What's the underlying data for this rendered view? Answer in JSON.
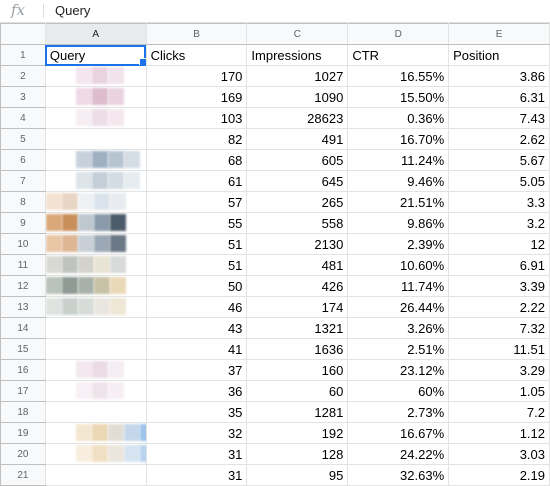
{
  "formula_bar": {
    "fx_label": "fx",
    "value": "Query"
  },
  "column_letters": [
    "A",
    "B",
    "C",
    "D",
    "E"
  ],
  "headers": {
    "query": "Query",
    "clicks": "Clicks",
    "impressions": "Impressions",
    "ctr": "CTR",
    "position": "Position"
  },
  "rows": [
    {
      "row": "1"
    },
    {
      "row": "2",
      "clicks": "170",
      "impressions": "1027",
      "ctr": "16.55%",
      "position": "3.86"
    },
    {
      "row": "3",
      "clicks": "169",
      "impressions": "1090",
      "ctr": "15.50%",
      "position": "6.31"
    },
    {
      "row": "4",
      "clicks": "103",
      "impressions": "28623",
      "ctr": "0.36%",
      "position": "7.43"
    },
    {
      "row": "5",
      "clicks": "82",
      "impressions": "491",
      "ctr": "16.70%",
      "position": "2.62"
    },
    {
      "row": "6",
      "clicks": "68",
      "impressions": "605",
      "ctr": "11.24%",
      "position": "5.67"
    },
    {
      "row": "7",
      "clicks": "61",
      "impressions": "645",
      "ctr": "9.46%",
      "position": "5.05"
    },
    {
      "row": "8",
      "clicks": "57",
      "impressions": "265",
      "ctr": "21.51%",
      "position": "3.3"
    },
    {
      "row": "9",
      "clicks": "55",
      "impressions": "558",
      "ctr": "9.86%",
      "position": "3.2"
    },
    {
      "row": "10",
      "clicks": "51",
      "impressions": "2130",
      "ctr": "2.39%",
      "position": "12"
    },
    {
      "row": "11",
      "clicks": "51",
      "impressions": "481",
      "ctr": "10.60%",
      "position": "6.91"
    },
    {
      "row": "12",
      "clicks": "50",
      "impressions": "426",
      "ctr": "11.74%",
      "position": "3.39"
    },
    {
      "row": "13",
      "clicks": "46",
      "impressions": "174",
      "ctr": "26.44%",
      "position": "2.22"
    },
    {
      "row": "14",
      "clicks": "43",
      "impressions": "1321",
      "ctr": "3.26%",
      "position": "7.32"
    },
    {
      "row": "15",
      "clicks": "41",
      "impressions": "1636",
      "ctr": "2.51%",
      "position": "11.51"
    },
    {
      "row": "16",
      "clicks": "37",
      "impressions": "160",
      "ctr": "23.12%",
      "position": "3.29"
    },
    {
      "row": "17",
      "clicks": "36",
      "impressions": "60",
      "ctr": "60%",
      "position": "1.05"
    },
    {
      "row": "18",
      "clicks": "35",
      "impressions": "1281",
      "ctr": "2.73%",
      "position": "7.2"
    },
    {
      "row": "19",
      "clicks": "32",
      "impressions": "192",
      "ctr": "16.67%",
      "position": "1.12"
    },
    {
      "row": "20",
      "clicks": "31",
      "impressions": "128",
      "ctr": "24.22%",
      "position": "3.03"
    },
    {
      "row": "21",
      "clicks": "31",
      "impressions": "95",
      "ctr": "32.63%",
      "position": "2.19"
    }
  ],
  "colors": {
    "selection": "#1a73e8",
    "header_bg": "#f8f9fa",
    "gridline": "#e2e3e3"
  },
  "icons": {
    "fx": "function-icon"
  }
}
